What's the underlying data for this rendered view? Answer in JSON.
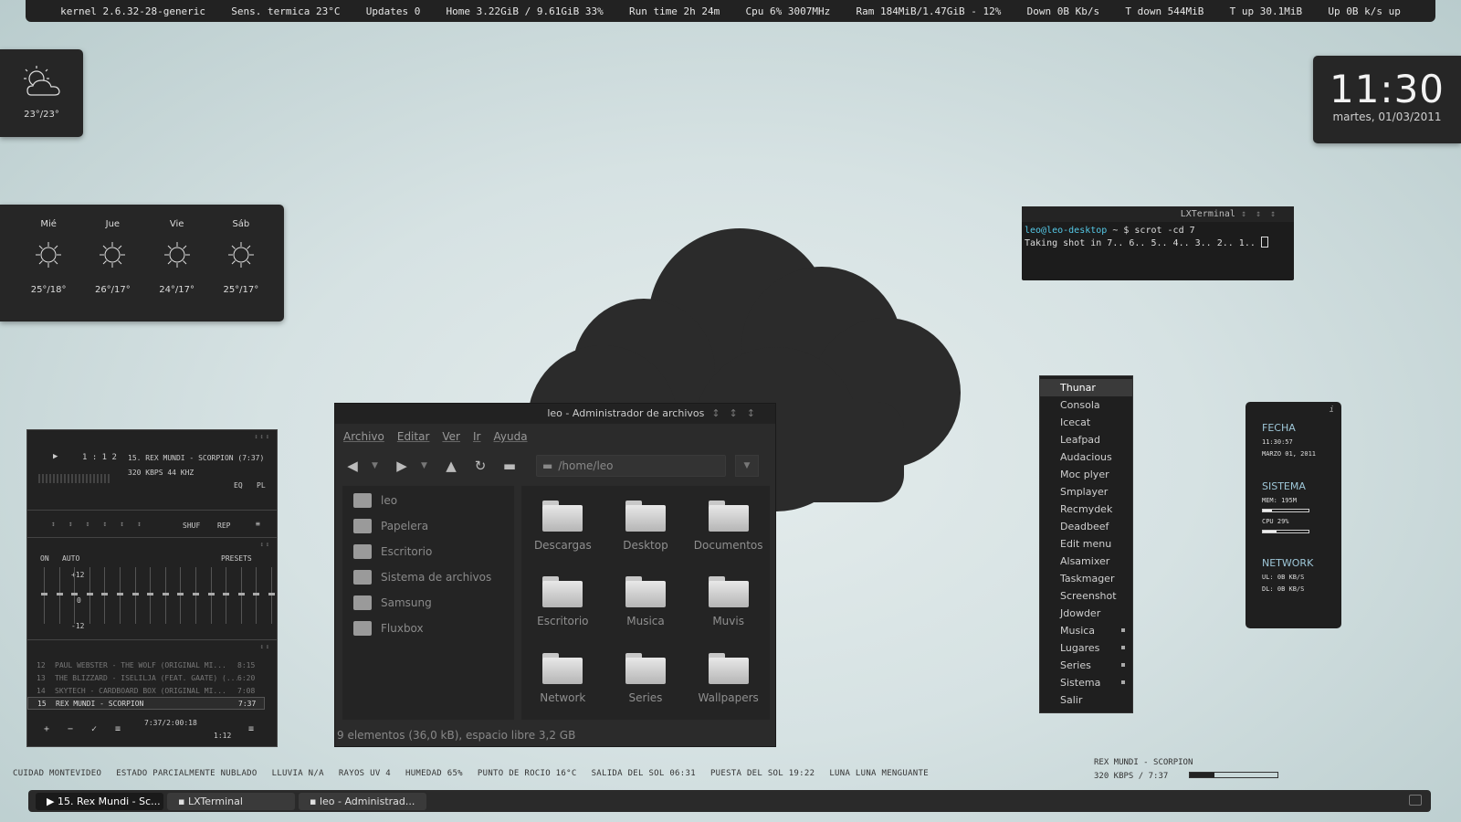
{
  "topbar": {
    "kernel": "kernel 2.6.32-28-generic",
    "temp": "Sens. termica 23°C",
    "updates": "Updates 0",
    "home": "Home 3.22GiB / 9.61GiB 33%",
    "runtime": "Run time 2h 24m",
    "cpu": "Cpu 6% 3007MHz",
    "ram": "Ram 184MiB/1.47GiB - 12%",
    "down": "Down 0B Kb/s",
    "tdown": "T down 544MiB",
    "tup": "T up 30.1MiB",
    "up": "Up 0B k/s up"
  },
  "weather_now": {
    "temp": "23°/23°",
    "icon": "partly-cloudy-icon"
  },
  "clock": {
    "time": "11:30",
    "date": "martes, 01/03/2011"
  },
  "forecast": [
    {
      "day": "Mié",
      "temp": "25°/18°",
      "icon": "sun-icon"
    },
    {
      "day": "Jue",
      "temp": "26°/17°",
      "icon": "sun-icon"
    },
    {
      "day": "Vie",
      "temp": "24°/17°",
      "icon": "sun-icon"
    },
    {
      "day": "Sáb",
      "temp": "25°/17°",
      "icon": "sun-icon"
    }
  ],
  "terminal": {
    "title": "LXTerminal",
    "prompt_user": "leo@leo-desktop",
    "prompt_rest": " ~ $ scrot -cd 7",
    "output": "Taking shot in 7.. 6.. 5.. 4.. 3.. 2.. 1.."
  },
  "file_manager": {
    "title": "leo - Administrador de archivos",
    "menu": [
      "Archivo",
      "Editar",
      "Ver",
      "Ir",
      "Ayuda"
    ],
    "path": "/home/leo",
    "sidebar": [
      "leo",
      "Papelera",
      "Escritorio",
      "Sistema de archivos",
      "Samsung",
      "Fluxbox"
    ],
    "files": [
      "Descargas",
      "Desktop",
      "Documentos",
      "Escritorio",
      "Musica",
      "Muvis",
      "Network",
      "Series",
      "Wallpapers"
    ],
    "status": "9 elementos (36,0 kB), espacio libre 3,2 GB"
  },
  "player": {
    "time": "1 : 1 2",
    "track": "15. REX MUNDI - SCORPION (7:37)",
    "bitrate": "320 KBPS  44 KHZ",
    "shuf": "SHUF",
    "rep": "REP",
    "eq": "EQ",
    "pl": "PL",
    "eq_on": "ON",
    "eq_auto": "AUTO",
    "presets": "PRESETS",
    "db_top": "+12",
    "db_mid": "0",
    "db_bot": "-12",
    "playlist": [
      {
        "n": "12",
        "title": "PAUL WEBSTER - THE WOLF (ORIGINAL MI...",
        "len": "8:15"
      },
      {
        "n": "13",
        "title": "THE BLIZZARD - ISELILJA (FEAT. GAATE) (...",
        "len": "6:20"
      },
      {
        "n": "14",
        "title": "SKYTECH - CARDBOARD BOX (ORIGINAL MI...",
        "len": "7:08"
      },
      {
        "n": "15",
        "title": "REX MUNDI - SCORPION",
        "len": "7:37"
      }
    ],
    "total": "7:37/2:00:18",
    "small_time": "1:12"
  },
  "app_menu": [
    {
      "label": "Thunar"
    },
    {
      "label": "Consola"
    },
    {
      "label": "Icecat"
    },
    {
      "label": "Leafpad"
    },
    {
      "label": "Audacious"
    },
    {
      "label": "Moc plyer"
    },
    {
      "label": "Smplayer"
    },
    {
      "label": "Recmydek"
    },
    {
      "label": "Deadbeef"
    },
    {
      "label": "Edit menu"
    },
    {
      "label": "Alsamixer"
    },
    {
      "label": "Taskmager"
    },
    {
      "label": "Screenshot"
    },
    {
      "label": "Jdowder"
    },
    {
      "label": "Musica"
    },
    {
      "label": "Lugares"
    },
    {
      "label": "Series"
    },
    {
      "label": "Sistema"
    },
    {
      "label": "Salir"
    }
  ],
  "sysinfo": {
    "info": "i",
    "fecha_h": "FECHA",
    "time": "11:30:57",
    "date": "MARZO 01, 2011",
    "sistema_h": "SISTEMA",
    "mem": "MEM: 195M",
    "mem_level": 0.2,
    "cpu": "CPU 29%",
    "cpu_level": 0.29,
    "network_h": "NETWORK",
    "ul": "UL: 0B   KB/S",
    "dl": "DL: 0B   KB/S"
  },
  "weather_line": [
    "CUIDAD MONTEVIDEO",
    "ESTADO PARCIALMENTE NUBLADO",
    "LLUVIA N/A",
    "RAYOS UV 4",
    "HUMEDAD 65%",
    "PUNTO DE ROCIO 16°C",
    "SALIDA DEL SOL 06:31",
    "PUESTA DEL SOL 19:22",
    "LUNA LUNA MENGUANTE"
  ],
  "now_playing": {
    "title": "REX MUNDI - SCORPION",
    "info": "320 KBPS / 7:37",
    "progress": 0.28
  },
  "taskbar": [
    {
      "label": "▶ 15. Rex Mundi - Sc..."
    },
    {
      "label": "LXTerminal"
    },
    {
      "label": "leo - Administrad..."
    }
  ]
}
